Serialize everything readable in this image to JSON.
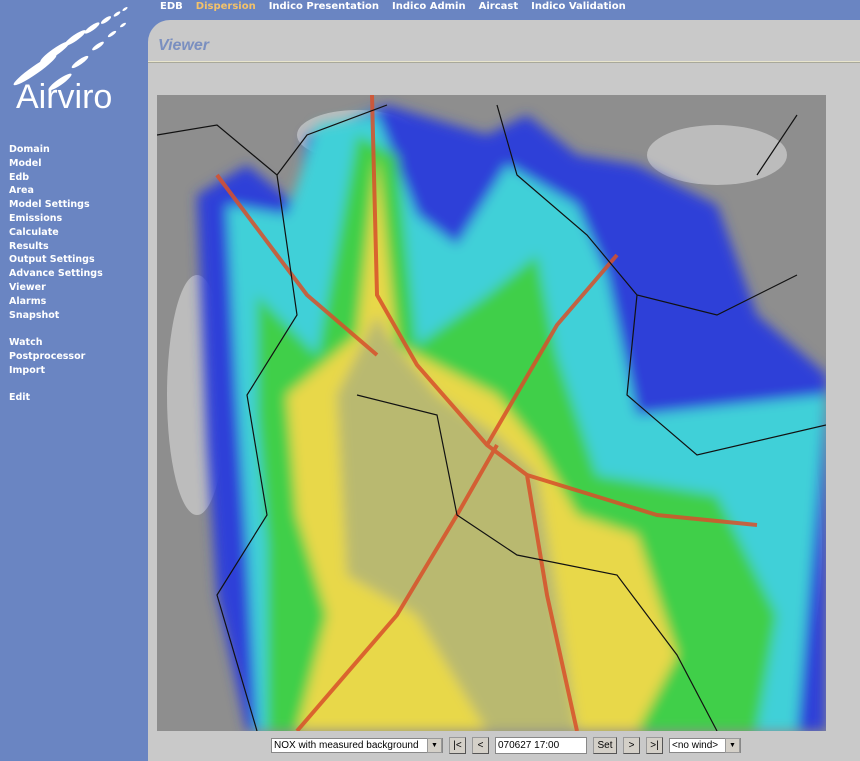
{
  "logo": {
    "text": "Airviro"
  },
  "topnav": [
    {
      "label": "EDB",
      "active": false
    },
    {
      "label": "Dispersion",
      "active": true
    },
    {
      "label": "Indico Presentation",
      "active": false
    },
    {
      "label": "Indico Admin",
      "active": false
    },
    {
      "label": "Aircast",
      "active": false
    },
    {
      "label": "Indico Validation",
      "active": false
    }
  ],
  "sidebar": {
    "group1": [
      "Domain",
      "Model",
      "Edb",
      "Area",
      "Model Settings",
      "Emissions",
      "Calculate",
      "Results",
      "Output Settings",
      "Advance Settings",
      "Viewer",
      "Alarms",
      "Snapshot"
    ],
    "group2": [
      "Watch",
      "Postprocessor",
      "Import"
    ],
    "group3": [
      "Edit"
    ]
  },
  "page": {
    "title": "Viewer"
  },
  "map": {
    "description_colors": [
      "#2d3fd8",
      "#3fd0d8",
      "#3fcf4a",
      "#e8d84a",
      "#d8502a"
    ]
  },
  "controls": {
    "substance": "NOX with measured background",
    "first": "|<",
    "prev": "<",
    "datetime": "070627 17:00",
    "set": "Set",
    "next": ">",
    "last": ">|",
    "wind": "<no wind>"
  },
  "colors": {
    "sidebar": "#6a85c2",
    "active_nav": "#f3c26a",
    "title": "#7a8fc0"
  }
}
